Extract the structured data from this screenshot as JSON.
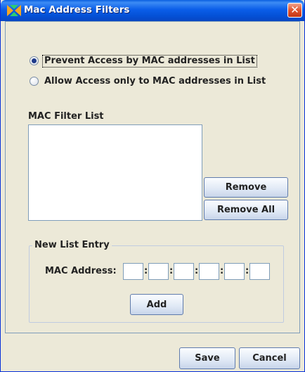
{
  "window": {
    "title": "Mac Address Filters",
    "close_glyph": "✕",
    "icon": "app-logo-icon"
  },
  "access_mode": {
    "options": [
      {
        "label": "Prevent Access by MAC addresses in List",
        "selected": true
      },
      {
        "label": "Allow Access only to MAC addresses in List",
        "selected": false
      }
    ]
  },
  "filter_list": {
    "label": "MAC Filter List",
    "items": [],
    "remove_label": "Remove",
    "remove_all_label": "Remove All"
  },
  "new_entry": {
    "legend": "New List Entry",
    "mac_label": "MAC Address:",
    "octets": [
      "",
      "",
      "",
      "",
      "",
      ""
    ],
    "separator": ":",
    "add_label": "Add"
  },
  "footer": {
    "save_label": "Save",
    "cancel_label": "Cancel"
  },
  "colors": {
    "titlebar": "#0451d6",
    "panel": "#ece9d8",
    "close": "#e0532e"
  }
}
